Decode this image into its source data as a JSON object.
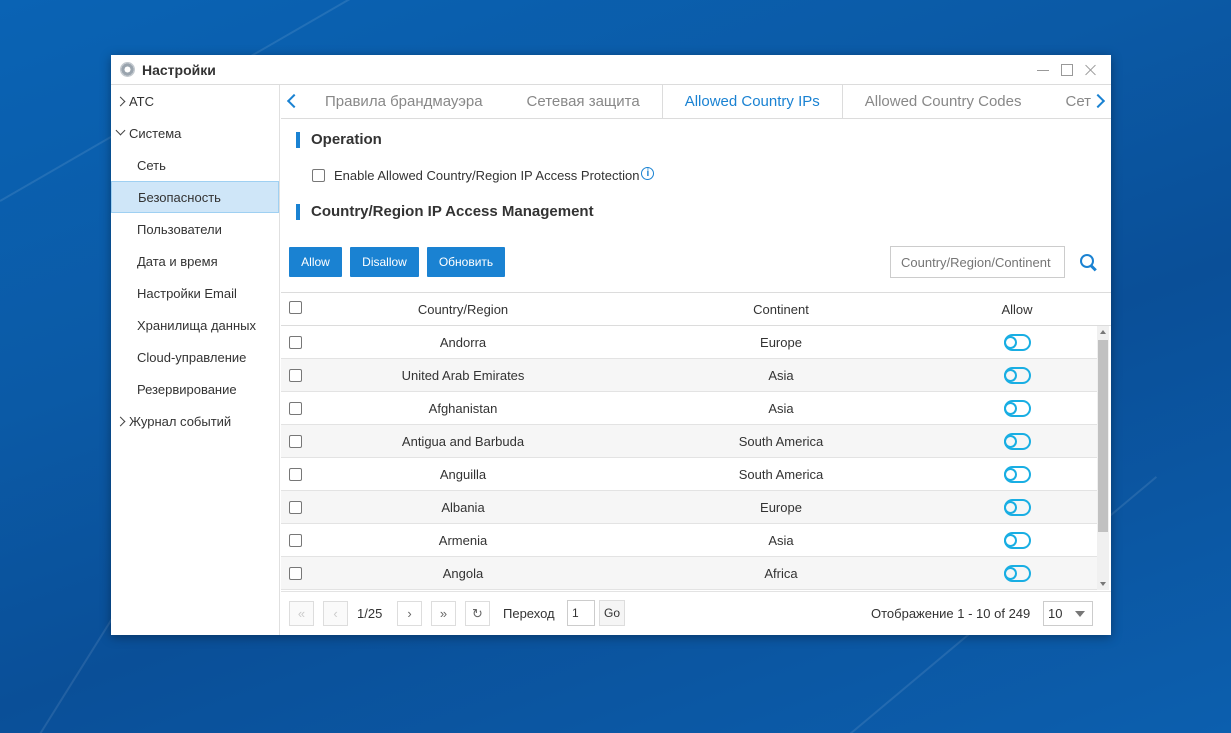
{
  "window": {
    "title": "Настройки"
  },
  "sidebar": {
    "items": [
      {
        "label": "АТС",
        "type": "group",
        "state": "collapsed"
      },
      {
        "label": "Система",
        "type": "group",
        "state": "expanded"
      },
      {
        "label": "Сеть",
        "type": "sub"
      },
      {
        "label": "Безопасность",
        "type": "sub",
        "active": true
      },
      {
        "label": "Пользователи",
        "type": "sub"
      },
      {
        "label": "Дата и время",
        "type": "sub"
      },
      {
        "label": "Настройки Email",
        "type": "sub"
      },
      {
        "label": "Хранилища данных",
        "type": "sub"
      },
      {
        "label": "Cloud-управление",
        "type": "sub"
      },
      {
        "label": "Резервирование",
        "type": "sub"
      },
      {
        "label": "Журнал событий",
        "type": "group",
        "state": "collapsed"
      }
    ]
  },
  "tabs": [
    {
      "label": "Правила брандмауэра"
    },
    {
      "label": "Сетевая защита"
    },
    {
      "label": "Allowed Country IPs",
      "active": true
    },
    {
      "label": "Allowed Country Codes"
    },
    {
      "label": "Сет"
    }
  ],
  "operation": {
    "title": "Operation",
    "checkbox_label": "Enable Allowed Country/Region IP Access Protection",
    "checked": false,
    "info_icon": "i"
  },
  "management": {
    "title": "Country/Region IP Access Management",
    "buttons": {
      "allow": "Allow",
      "disallow": "Disallow",
      "refresh": "Обновить"
    },
    "search_placeholder": "Country/Region/Continent"
  },
  "table": {
    "headers": {
      "country": "Country/Region",
      "continent": "Continent",
      "allow": "Allow"
    },
    "rows": [
      {
        "country": "Andorra",
        "continent": "Europe",
        "allow": false
      },
      {
        "country": "United Arab Emirates",
        "continent": "Asia",
        "allow": false
      },
      {
        "country": "Afghanistan",
        "continent": "Asia",
        "allow": false
      },
      {
        "country": "Antigua and Barbuda",
        "continent": "South America",
        "allow": false
      },
      {
        "country": "Anguilla",
        "continent": "South America",
        "allow": false
      },
      {
        "country": "Albania",
        "continent": "Europe",
        "allow": false
      },
      {
        "country": "Armenia",
        "continent": "Asia",
        "allow": false
      },
      {
        "country": "Angola",
        "continent": "Africa",
        "allow": false
      }
    ]
  },
  "pager": {
    "page_indicator": "1/25",
    "goto_label": "Переход",
    "goto_value": "1",
    "go_label": "Go",
    "summary": "Отображение 1 - 10 of 249",
    "page_size": "10"
  },
  "colors": {
    "accent": "#1a82d2",
    "toggle": "#19aee3",
    "active_nav": "#cfe6f8"
  }
}
